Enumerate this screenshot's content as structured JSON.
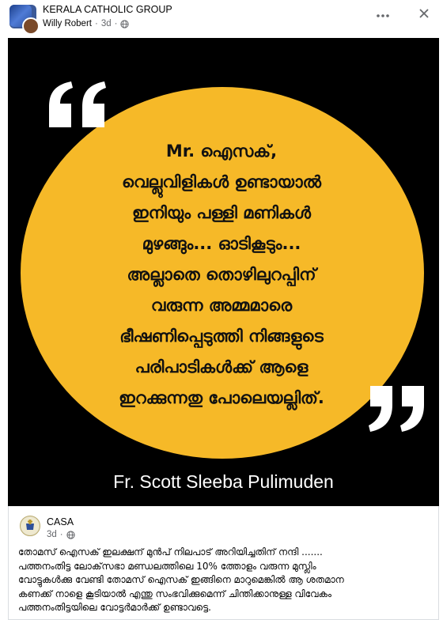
{
  "post": {
    "group_name": "KERALA CATHOLIC GROUP",
    "author": "Willy Robert",
    "time": "3d",
    "separator": "·",
    "more_icon": "more-horizontal-icon",
    "close_icon": "close-icon",
    "privacy_icon": "globe-icon"
  },
  "image": {
    "background_color": "#000000",
    "circle_color": "#f6b928",
    "quote_lines": [
      "Mr. ഐസക്,",
      "വെല്ലുവിളികൾ ഉണ്ടായാൽ",
      "ഇനിയും പള്ളി മണികൾ",
      "മുഴങ്ങും... ഓടികൂടും...",
      "അല്ലാതെ തൊഴിലുറപ്പിന്",
      "വരുന്ന അമ്മമാരെ",
      "ഭീഷണിപ്പെടുത്തി നിങ്ങളുടെ",
      "പരിപാടികൾക്ക് ആളെ",
      "ഇറക്കുന്നതു പോലെയല്ലിത്."
    ],
    "credit": "Fr. Scott Sleeba Pulimuden"
  },
  "shared": {
    "page_name": "CASA",
    "time": "3d",
    "separator": "·",
    "privacy_icon": "globe-icon",
    "text_lines": [
      "തോമസ് ഐസക് ഇലക്ഷന് മുൻപ് നിലപാട് അറിയിച്ചതിന് നന്ദി .......",
      "പത്തനംതിട്ട ലോക്‌സഭാ മണ്ഡലത്തിലെ 10% ത്തോളം വരുന്ന മുസ്ലിം",
      "വോട്ടുകൾക്കു വേണ്ടി തോമസ് ഐസക് ഇങ്ങിനെ മാറുമെങ്കിൽ ആ ശതമാന",
      "കണക്ക് നാളെ കൂടിയാൽ എന്തു സംഭവിക്കുമെന്ന് ചിന്തിക്കാനുള്ള വിവേകം",
      "പത്തനംതിട്ടയിലെ വോട്ടർമാർക്ക് ഉണ്ടാവട്ടെ."
    ]
  }
}
